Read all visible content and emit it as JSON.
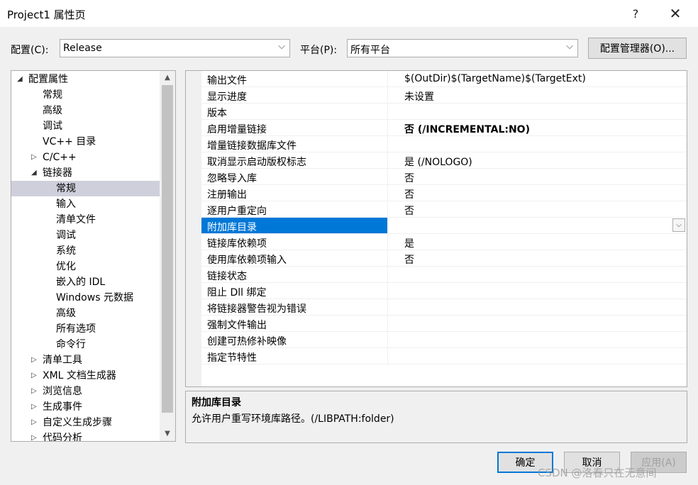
{
  "window": {
    "title": "Project1 属性页",
    "help": "?",
    "close": "✕"
  },
  "toolbar": {
    "config_label": "配置(C):",
    "config_value": "Release",
    "platform_label": "平台(P):",
    "platform_value": "所有平台",
    "config_manager": "配置管理器(O)..."
  },
  "tree": {
    "items": [
      {
        "label": "配置属性"
      },
      {
        "label": "常规"
      },
      {
        "label": "高级"
      },
      {
        "label": "调试"
      },
      {
        "label": "VC++ 目录"
      },
      {
        "label": "C/C++"
      },
      {
        "label": "链接器"
      },
      {
        "label": "常规"
      },
      {
        "label": "输入"
      },
      {
        "label": "清单文件"
      },
      {
        "label": "调试"
      },
      {
        "label": "系统"
      },
      {
        "label": "优化"
      },
      {
        "label": "嵌入的 IDL"
      },
      {
        "label": "Windows 元数据"
      },
      {
        "label": "高级"
      },
      {
        "label": "所有选项"
      },
      {
        "label": "命令行"
      },
      {
        "label": "清单工具"
      },
      {
        "label": "XML 文档生成器"
      },
      {
        "label": "浏览信息"
      },
      {
        "label": "生成事件"
      },
      {
        "label": "自定义生成步骤"
      },
      {
        "label": "代码分析"
      }
    ]
  },
  "properties": [
    {
      "name": "输出文件",
      "value": "$(OutDir)$(TargetName)$(TargetExt)"
    },
    {
      "name": "显示进度",
      "value": "未设置"
    },
    {
      "name": "版本",
      "value": ""
    },
    {
      "name": "启用增量链接",
      "value": "否 (/INCREMENTAL:NO)"
    },
    {
      "name": "增量链接数据库文件",
      "value": ""
    },
    {
      "name": "取消显示启动版权标志",
      "value": "是 (/NOLOGO)"
    },
    {
      "name": "忽略导入库",
      "value": "否"
    },
    {
      "name": "注册输出",
      "value": "否"
    },
    {
      "name": "逐用户重定向",
      "value": "否"
    },
    {
      "name": "附加库目录",
      "value": ""
    },
    {
      "name": "链接库依赖项",
      "value": "是"
    },
    {
      "name": "使用库依赖项输入",
      "value": "否"
    },
    {
      "name": "链接状态",
      "value": ""
    },
    {
      "name": "阻止 Dll 绑定",
      "value": ""
    },
    {
      "name": "将链接器警告视为错误",
      "value": ""
    },
    {
      "name": "强制文件输出",
      "value": ""
    },
    {
      "name": "创建可热修补映像",
      "value": ""
    },
    {
      "name": "指定节特性",
      "value": ""
    }
  ],
  "description": {
    "title": "附加库目录",
    "text": "允许用户重写环境库路径。(/LIBPATH:folder)"
  },
  "buttons": {
    "ok": "确定",
    "cancel": "取消",
    "apply": "应用(A)"
  },
  "watermark": "CSDN @洛春只在无意间",
  "colors": {
    "selection": "#0078d7",
    "tree_selection": "#cfcfdc"
  }
}
